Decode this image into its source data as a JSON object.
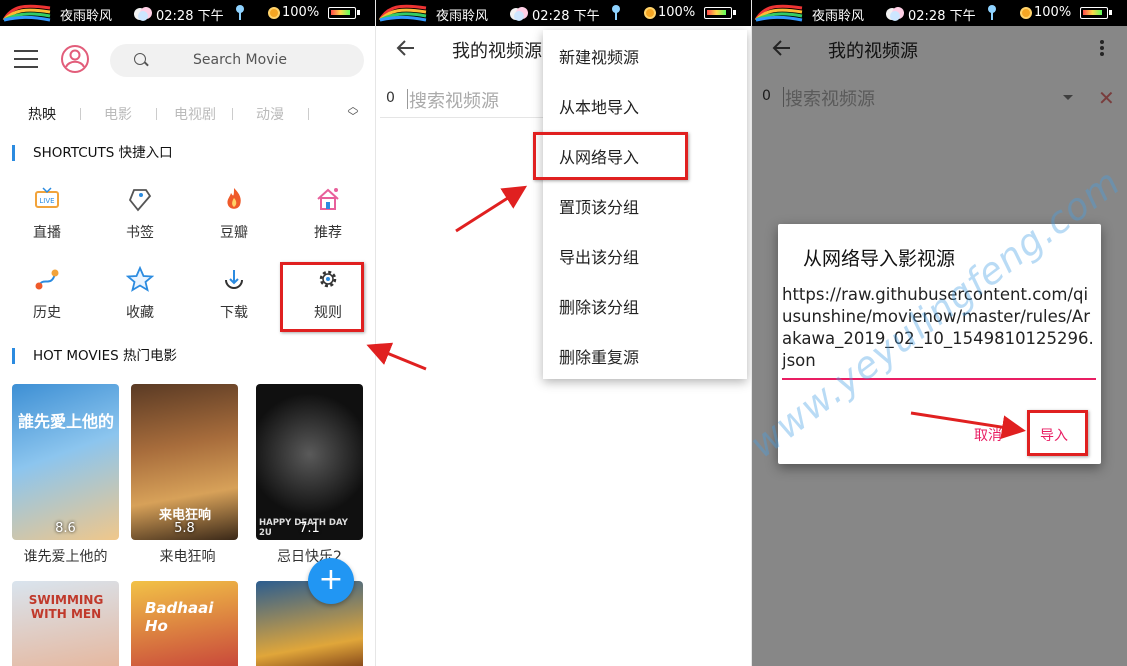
{
  "status_bar": {
    "app_name": "夜雨聆风",
    "time": "02:28 下午",
    "battery": "100%"
  },
  "screen1": {
    "search_placeholder": "Search Movie",
    "tabs": [
      "热映",
      "电影",
      "电视剧",
      "动漫"
    ],
    "shortcuts_header": "SHORTCUTS 快捷入口",
    "shortcuts": [
      {
        "label": "直播",
        "icon": "live-tv-icon"
      },
      {
        "label": "书签",
        "icon": "bookmark-tag-icon"
      },
      {
        "label": "豆瓣",
        "icon": "flame-icon"
      },
      {
        "label": "推荐",
        "icon": "home-icon"
      },
      {
        "label": "历史",
        "icon": "history-path-icon"
      },
      {
        "label": "收藏",
        "icon": "star-icon"
      },
      {
        "label": "下载",
        "icon": "download-icon"
      },
      {
        "label": "规则",
        "icon": "gear-icon"
      }
    ],
    "hot_header": "HOT MOVIES 热门电影",
    "movies": [
      {
        "title": "谁先爱上他的",
        "score": "8.6",
        "poster_text": "誰先愛上他的",
        "color1": "#3d8fd4",
        "color2": "#f0c78a"
      },
      {
        "title": "来电狂响",
        "score": "5.8",
        "poster_text": "来电狂响",
        "color1": "#5a3a24",
        "color2": "#d7a159"
      },
      {
        "title": "忌日快乐2",
        "score": "7.1",
        "poster_text": "HAPPY DEATH DAY 2U",
        "color1": "#101010",
        "color2": "#3a3a3a"
      }
    ],
    "row2_posters": [
      {
        "poster_text": "SWIMMING WITH MEN",
        "color1": "#d9e4ee",
        "color2": "#e6b69c"
      },
      {
        "poster_text": "Badhaai Ho",
        "color1": "#f2c247",
        "color2": "#c7433a"
      },
      {
        "poster_text": "",
        "color1": "#2c5d8f",
        "color2": "#e0a63a"
      }
    ]
  },
  "screen2": {
    "title": "我的视频源",
    "index": "0",
    "search_placeholder": "搜索视频源",
    "menu": [
      "新建视频源",
      "从本地导入",
      "从网络导入",
      "置顶该分组",
      "导出该分组",
      "删除该分组",
      "删除重复源"
    ]
  },
  "screen3": {
    "title": "我的视频源",
    "index": "0",
    "search_placeholder": "搜索视频源",
    "dialog_title": "从网络导入影视源",
    "url": "https://raw.githubusercontent.com/qiusunshine/movienow/master/rules/Arakawa_2019_02_10_1549810125296.json",
    "cancel": "取消",
    "import": "导入"
  },
  "watermark": "www.yeyulingfeng.com",
  "colors": {
    "accent_blue": "#2196f3",
    "highlight_red": "#e02020",
    "dialog_pink": "#e91e63"
  }
}
